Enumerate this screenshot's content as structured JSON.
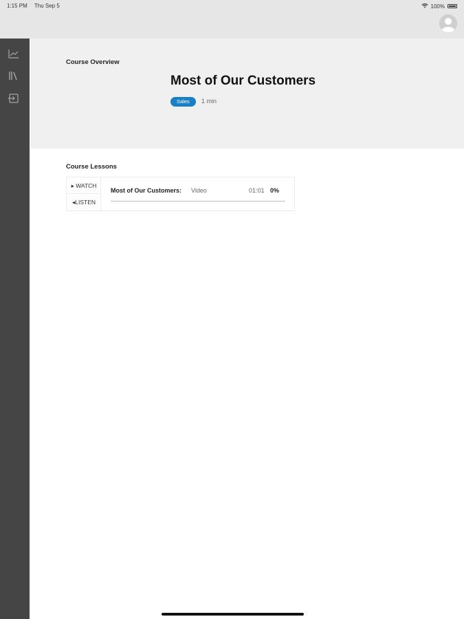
{
  "status_bar": {
    "time": "1:15 PM",
    "date": "Thu Sep 5",
    "battery": "100%"
  },
  "header": {
    "avatar_icon": "user-avatar-icon"
  },
  "sidebar": {
    "items": [
      {
        "icon": "chart-line-icon"
      },
      {
        "icon": "library-icon"
      },
      {
        "icon": "sign-in-icon"
      }
    ]
  },
  "overview": {
    "label": "Course Overview",
    "title": "Most of Our Customers",
    "tag": "Sales",
    "duration": "1 min"
  },
  "lessons": {
    "label": "Course Lessons",
    "items": [
      {
        "watch_label": "WATCH",
        "listen_label": "LISTEN",
        "name": "Most of Our Customers:",
        "type": "Video",
        "time": "01:01",
        "progress_text": "0%",
        "progress": 0
      }
    ]
  },
  "colors": {
    "accent": "#1a7fc4",
    "rail": "#454545",
    "header_bg": "#e6e6e6",
    "overview_bg": "#f0f0f0"
  }
}
